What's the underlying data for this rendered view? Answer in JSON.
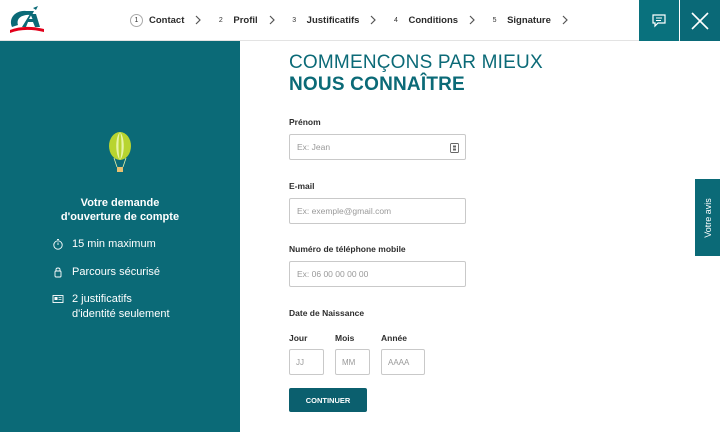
{
  "brand": {
    "logo_text": "CA",
    "primary_color": "#0b6a77",
    "accent_red": "#e2001a"
  },
  "steps": [
    {
      "num": "1",
      "label": "Contact"
    },
    {
      "num": "2",
      "label": "Profil"
    },
    {
      "num": "3",
      "label": "Justificatifs"
    },
    {
      "num": "4",
      "label": "Conditions"
    },
    {
      "num": "5",
      "label": "Signature"
    }
  ],
  "header_icons": {
    "chat": "chat-bubble-icon",
    "close": "close-x-icon"
  },
  "left": {
    "title_line1": "Votre demande",
    "title_line2": "d'ouverture de compte",
    "features": [
      {
        "icon": "stopwatch-icon",
        "text": "15 min maximum"
      },
      {
        "icon": "lock-icon",
        "text": "Parcours sécurisé"
      },
      {
        "icon": "id-card-icon",
        "text_line1": "2 justificatifs",
        "text_line2": "d'identité seulement"
      }
    ]
  },
  "form": {
    "heading_line1": "COMMENÇONS PAR MIEUX",
    "heading_line2": "NOUS CONNAÎTRE",
    "prenom": {
      "label": "Prénom",
      "placeholder": "Ex: Jean"
    },
    "email": {
      "label": "E-mail",
      "placeholder": "Ex: exemple@gmail.com"
    },
    "phone": {
      "label": "Numéro de téléphone mobile",
      "placeholder": "Ex: 06 00 00 00 00"
    },
    "birth": {
      "label": "Date de Naissance",
      "day_label": "Jour",
      "day_placeholder": "JJ",
      "month_label": "Mois",
      "month_placeholder": "MM",
      "year_label": "Année",
      "year_placeholder": "AAAA"
    },
    "continue_label": "CONTINUER"
  },
  "feedback_label": "Votre avis"
}
